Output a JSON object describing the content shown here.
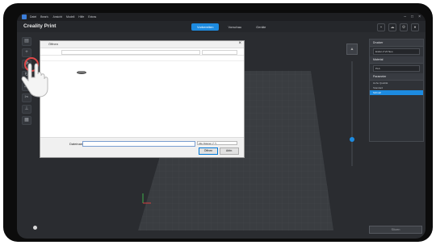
{
  "menubar": {
    "items": [
      "Datei",
      "Bearb.",
      "Ansicht",
      "Modell",
      "Hilfe",
      "Extras"
    ]
  },
  "window_controls": [
    "–",
    "□",
    "×"
  ],
  "titlebar": {
    "brand": "Creality Print",
    "tabs": [
      {
        "label": "Vorbereiten",
        "active": true
      },
      {
        "label": "Vorschau",
        "active": false
      },
      {
        "label": "Geräte",
        "active": false
      }
    ]
  },
  "top_icons": [
    "save-icon",
    "cloud-icon",
    "gear-icon",
    "user-icon"
  ],
  "toolbar": {
    "tools": [
      "open-file-icon",
      "add-icon",
      "move-icon",
      "rotate-icon",
      "scale-icon",
      "cut-icon",
      "support-icon",
      "layout-icon"
    ]
  },
  "dialog": {
    "title": "Öffnen",
    "filename_label": "Dateiname:",
    "filename_value": "",
    "filetype_value": "Alle Dateien (*.*)",
    "open_label": "Öffnen",
    "cancel_label": "Abbr."
  },
  "right_panel": {
    "printer_header": "Drucker",
    "printer_value": "Ender-3 V2 Neo",
    "material_header": "Material",
    "material_value": "PLA",
    "settings_header": "Parameter",
    "profiles": [
      "Hohe Qualität",
      "Standard",
      "Schnell"
    ],
    "selected_profile_index": 2
  },
  "slice_button": {
    "label": "Slicen"
  },
  "colors": {
    "accent": "#1d8be0",
    "background": "#2a2c30",
    "plate": "#3a3d41"
  }
}
